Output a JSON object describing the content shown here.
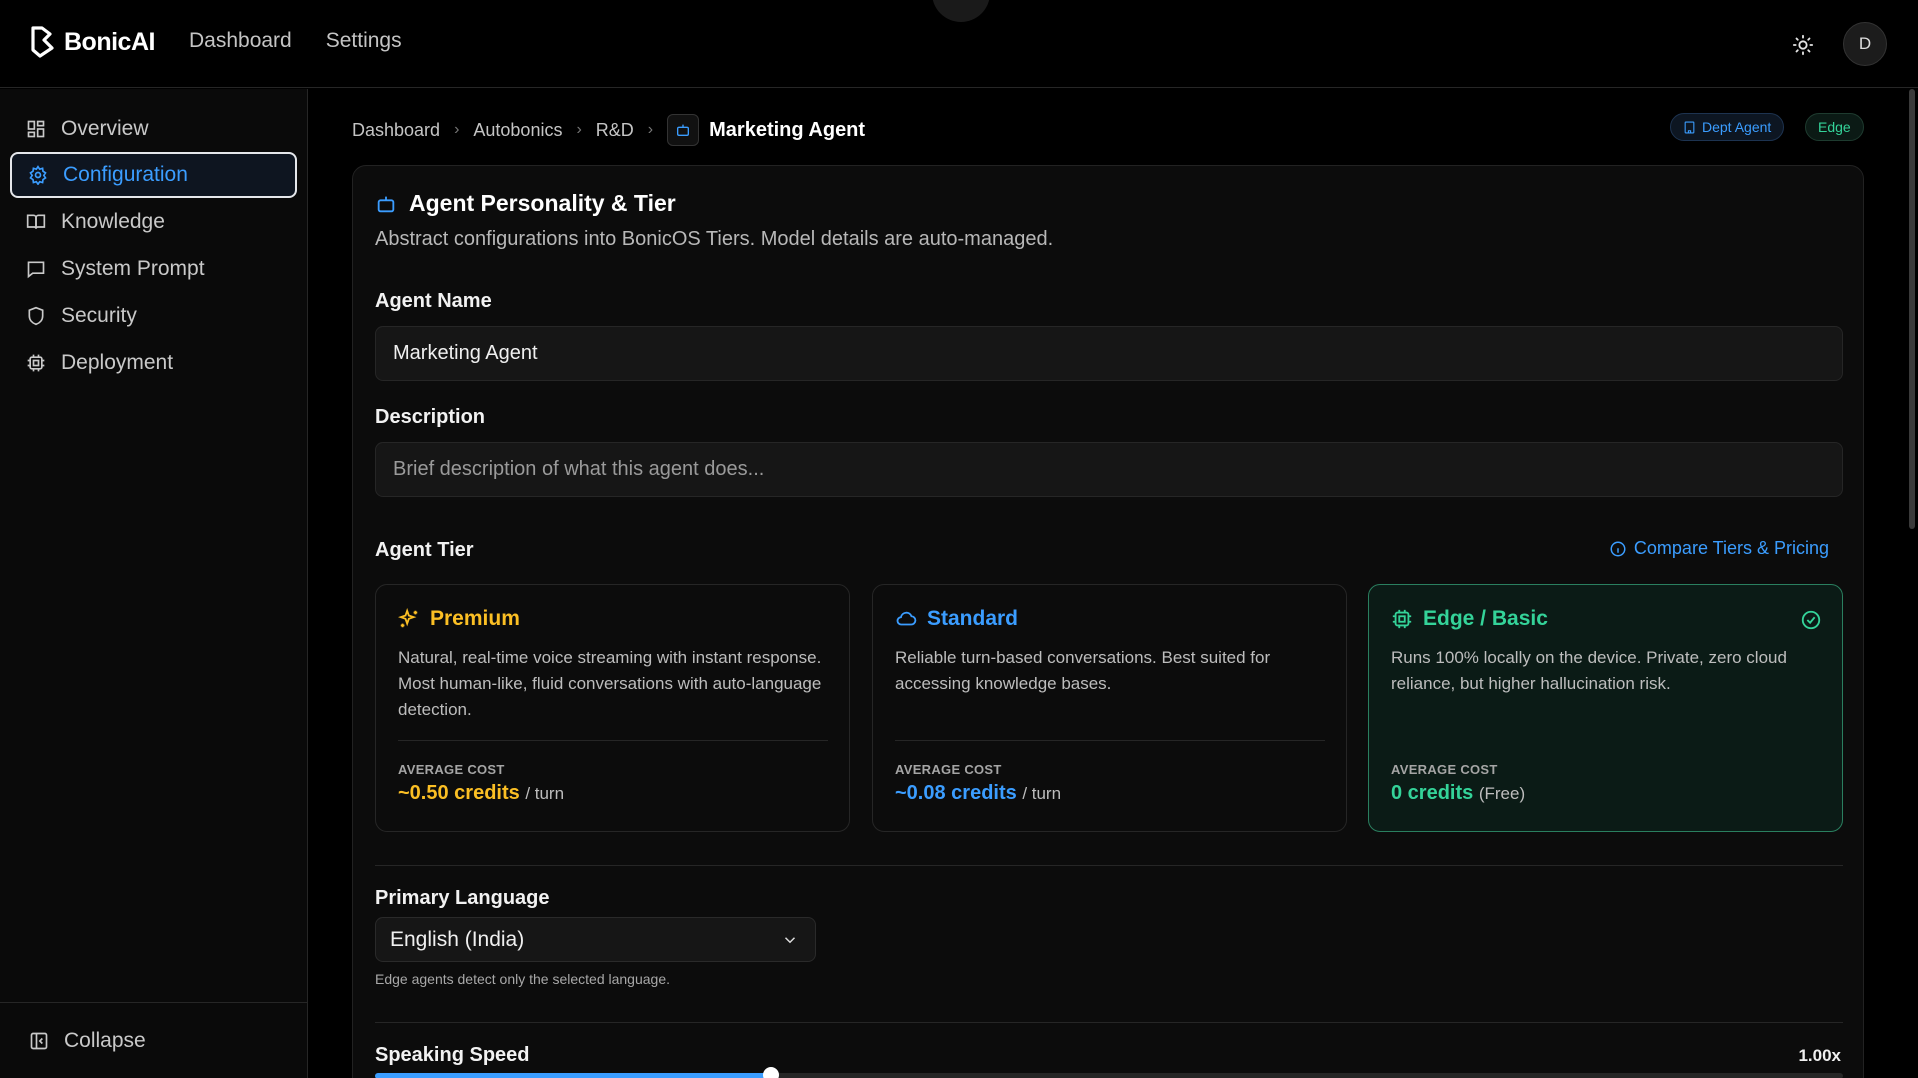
{
  "app": {
    "name": "BonicAI"
  },
  "topnav": {
    "items": [
      "Dashboard",
      "Settings"
    ]
  },
  "user": {
    "avatar_initial": "D"
  },
  "sidebar": {
    "items": [
      {
        "label": "Overview",
        "icon": "grid-icon"
      },
      {
        "label": "Configuration",
        "icon": "gear-icon"
      },
      {
        "label": "Knowledge",
        "icon": "book-icon"
      },
      {
        "label": "System Prompt",
        "icon": "chat-icon"
      },
      {
        "label": "Security",
        "icon": "shield-icon"
      },
      {
        "label": "Deployment",
        "icon": "chip-icon"
      }
    ],
    "active_index": 1,
    "collapse_label": "Collapse"
  },
  "breadcrumb": {
    "items": [
      "Dashboard",
      "Autobonics",
      "R&D"
    ],
    "current": "Marketing Agent"
  },
  "badges": {
    "dept": "Dept Agent",
    "edge": "Edge"
  },
  "card": {
    "title": "Agent Personality & Tier",
    "subtitle": "Abstract configurations into BonicOS Tiers. Model details are auto-managed."
  },
  "form": {
    "agent_name_label": "Agent Name",
    "agent_name_value": "Marketing Agent",
    "description_label": "Description",
    "description_placeholder": "Brief description of what this agent does...",
    "tier_label": "Agent Tier",
    "compare_link": "Compare Tiers & Pricing",
    "language_label": "Primary Language",
    "language_value": "English (India)",
    "language_hint": "Edge agents detect only the selected language.",
    "speed_label": "Speaking Speed",
    "speed_value": "1.00x",
    "speed_fraction": 0.27
  },
  "tiers": [
    {
      "name": "Premium",
      "icon": "sparkles-icon",
      "color": "#fbbf24",
      "desc": "Natural, real-time voice streaming with instant response. Most human-like, fluid conversations with auto-language detection.",
      "cost_label": "AVERAGE COST",
      "cost": "~0.50 credits",
      "unit": "/ turn"
    },
    {
      "name": "Standard",
      "icon": "cloud-icon",
      "color": "#3b9dff",
      "desc": "Reliable turn-based conversations. Best suited for accessing knowledge bases.",
      "cost_label": "AVERAGE COST",
      "cost": "~0.08 credits",
      "unit": "/ turn"
    },
    {
      "name": "Edge / Basic",
      "icon": "chip-icon",
      "color": "#34d399",
      "desc": "Runs 100% locally on the device. Private, zero cloud reliance, but higher hallucination risk.",
      "cost_label": "AVERAGE COST",
      "cost": "0 credits",
      "unit": "(Free)"
    }
  ],
  "selected_tier": 2
}
